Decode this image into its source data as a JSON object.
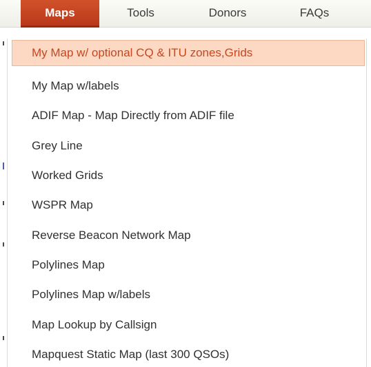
{
  "nav": {
    "tabs": [
      {
        "label": "Maps",
        "active": true
      },
      {
        "label": "Tools",
        "active": false
      },
      {
        "label": "Donors",
        "active": false
      },
      {
        "label": "FAQs",
        "active": false
      }
    ]
  },
  "menu": {
    "items": [
      {
        "label": "My Map w/ optional CQ & ITU zones,Grids",
        "highlighted": true
      },
      {
        "label": "My Map w/labels"
      },
      {
        "label": "ADIF Map - Map Directly from ADIF file"
      },
      {
        "label": "Grey Line"
      },
      {
        "label": "Worked Grids"
      },
      {
        "label": "WSPR Map"
      },
      {
        "label": "Reverse Beacon Network Map"
      },
      {
        "label": "Polylines Map"
      },
      {
        "label": "Polylines Map w/labels"
      },
      {
        "label": "Map Lookup by Callsign"
      },
      {
        "label": "Mapquest Static Map (last 300 QSOs)"
      }
    ]
  },
  "colors": {
    "active_tab": "#c4441f",
    "highlight_bg": "#fdd9c3",
    "highlight_text": "#c8461f",
    "menu_text": "#303030"
  }
}
